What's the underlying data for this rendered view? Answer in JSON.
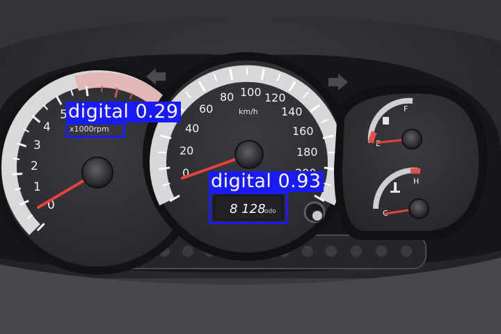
{
  "tachometer": {
    "ticks": [
      "0",
      "1",
      "2",
      "3",
      "4",
      "5"
    ],
    "unit": "x1000rpm"
  },
  "speedometer": {
    "ticks": [
      "0",
      "20",
      "40",
      "60",
      "80",
      "100",
      "120",
      "140",
      "160",
      "180",
      "200"
    ],
    "unit": "km/h"
  },
  "odometer": {
    "value": "8 128",
    "unit": "odo"
  },
  "fuel_gauge": {
    "full": "F",
    "empty": "E"
  },
  "temp_gauge": {
    "hot": "H",
    "cold": "C"
  },
  "detections": [
    {
      "label": "digital 0.29",
      "confidence": 0.29
    },
    {
      "label": "digital 0.93",
      "confidence": 0.93
    }
  ],
  "colors": {
    "detection_box": "#1a1aff",
    "needle": "#e8423a",
    "redline": "#e05050"
  }
}
